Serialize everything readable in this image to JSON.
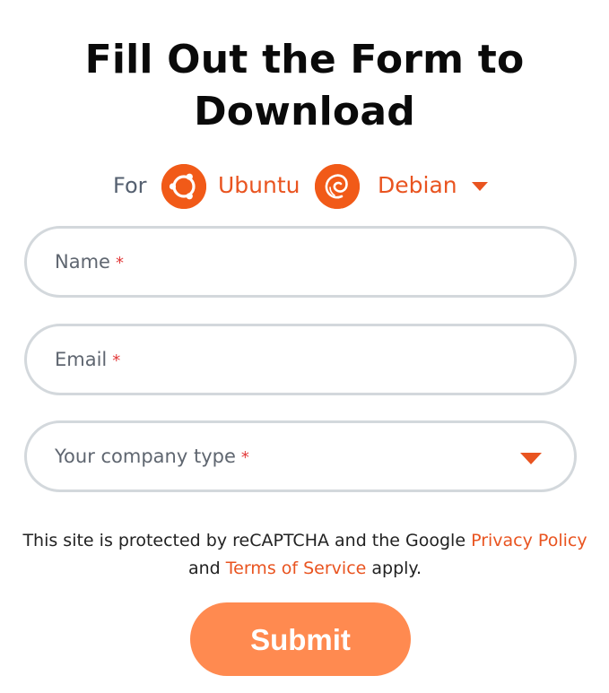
{
  "heading": {
    "line1": "Fill Out the Form to",
    "line2": "Download"
  },
  "os_selector": {
    "for_label": "For",
    "options": [
      {
        "name": "Ubuntu",
        "icon": "ubuntu-logo-icon"
      },
      {
        "name": "Debian",
        "icon": "debian-logo-icon"
      }
    ],
    "dropdown_icon": "caret-down-icon"
  },
  "form": {
    "name_label": "Name",
    "email_label": "Email",
    "company_type_label": "Your company type",
    "required_marker": "*"
  },
  "notice": {
    "text_before": "This site is protected by reCAPTCHA and the Google",
    "privacy_link": "Privacy Policy",
    "and": "and",
    "terms_link": "Terms of Service",
    "text_after": "apply."
  },
  "submit_label": "Submit",
  "colors": {
    "accent": "#e95420",
    "submit_bg": "#ff8a50",
    "field_border": "#d3d8dc",
    "required": "#e23a3a"
  }
}
